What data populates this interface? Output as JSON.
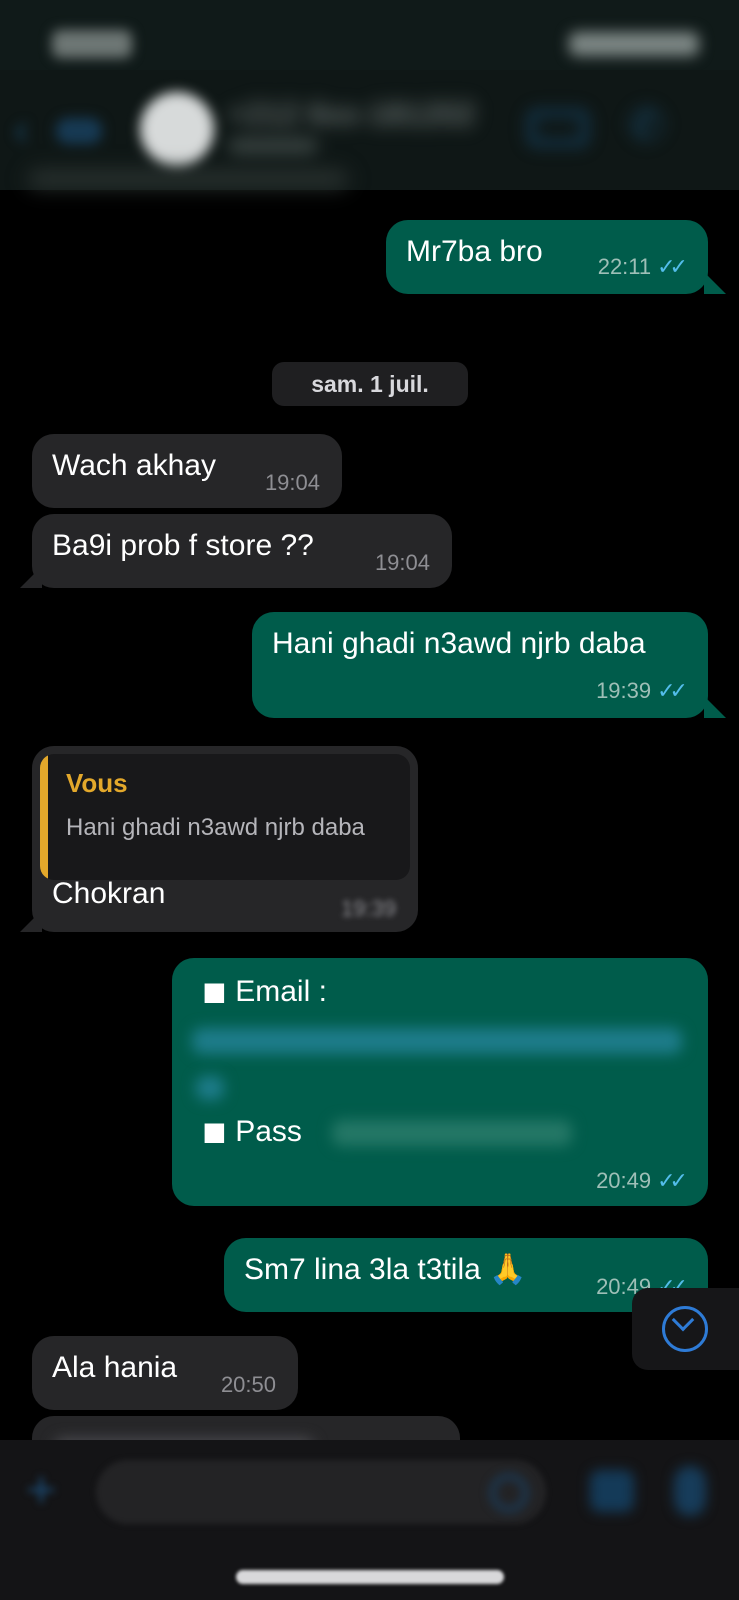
{
  "header": {
    "contact_name": "+212 6xx-181202",
    "back_icon": "chevron-left-icon",
    "video_icon": "video-camera-icon",
    "call_icon": "phone-icon"
  },
  "date_separator": "sam. 1 juil.",
  "messages": [
    {
      "dir": "out",
      "text": "Mr7ba bro",
      "time": "22:11",
      "ticks": "✓✓"
    },
    {
      "dir": "in",
      "text": "Wach akhay",
      "time": "19:04"
    },
    {
      "dir": "in",
      "text": "Ba9i prob f store ??",
      "time": "19:04"
    },
    {
      "dir": "out",
      "text": "Hani ghadi n3awd njrb daba",
      "time": "19:39",
      "ticks": "✓✓"
    },
    {
      "dir": "in",
      "quote_author": "Vous",
      "quote_text": "Hani ghadi n3awd njrb daba",
      "text": "Chokran",
      "time": "19:39"
    },
    {
      "dir": "out",
      "line1": "◼ Email :",
      "line2": "◼ Pass",
      "time": "20:49",
      "ticks": "✓✓"
    },
    {
      "dir": "out",
      "text": "Sm7 lina 3la t3tila 🙏",
      "time": "20:49",
      "ticks": "✓✓"
    },
    {
      "dir": "in",
      "text": "Ala hania",
      "time": "20:50"
    }
  ],
  "colors": {
    "outgoing_bubble": "#005c4b",
    "incoming_bubble": "#262628",
    "quote_accent": "#e3a82b",
    "read_ticks": "#53bdeb"
  },
  "icons": {
    "scroll_down": "chevron-down-circle-icon",
    "attach": "plus-icon",
    "sticker": "sticker-icon",
    "camera": "camera-icon",
    "mic": "microphone-icon"
  }
}
